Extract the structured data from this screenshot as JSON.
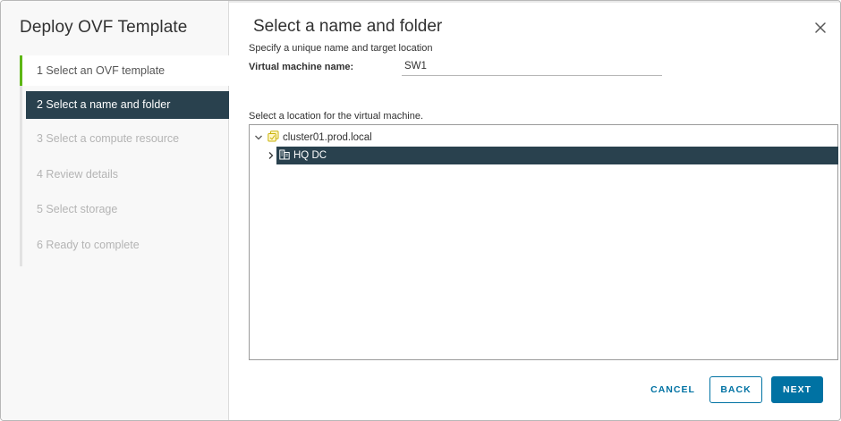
{
  "wizard": {
    "title": "Deploy OVF Template",
    "steps": [
      {
        "label": "1  Select an OVF template",
        "state": "completed"
      },
      {
        "label": "2  Select a name and folder",
        "state": "current"
      },
      {
        "label": "3  Select a compute resource",
        "state": "disabled"
      },
      {
        "label": "4  Review details",
        "state": "disabled"
      },
      {
        "label": "5  Select storage",
        "state": "disabled"
      },
      {
        "label": "6  Ready to complete",
        "state": "disabled"
      }
    ]
  },
  "page": {
    "title": "Select a name and folder",
    "subtitle": "Specify a unique name and target location",
    "vm_name_label": "Virtual machine name:",
    "vm_name_value": "SW1",
    "location_label": "Select a location for the virtual machine."
  },
  "tree": {
    "root": {
      "label": "cluster01.prod.local",
      "icon": "vcenter-icon",
      "expanded": true
    },
    "children": [
      {
        "label": "HQ DC",
        "icon": "datacenter-icon",
        "expanded": false,
        "selected": true
      }
    ]
  },
  "footer": {
    "cancel_label": "CANCEL",
    "back_label": "BACK",
    "next_label": "NEXT"
  },
  "colors": {
    "accent": "#0072a3",
    "selection": "#29414e",
    "progress_green": "#5eb715",
    "cluster_icon": "#c9b30a"
  }
}
